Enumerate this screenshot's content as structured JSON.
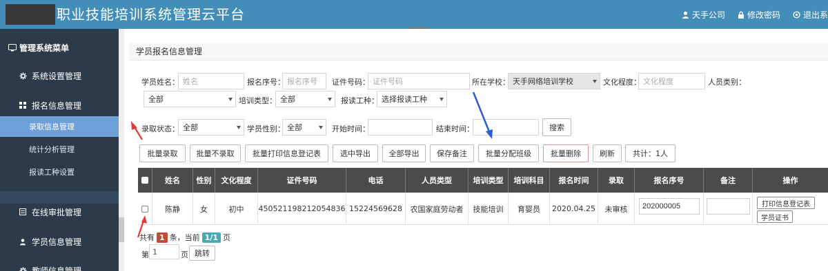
{
  "header": {
    "title": "职业技能培训系统管理云平台",
    "company": "天手公司",
    "change_password": "修改密码",
    "logout": "退出系"
  },
  "sidebar": {
    "menu_title": "管理系统菜单",
    "items": [
      {
        "label": "系统设置管理",
        "icon": "gear-icon"
      },
      {
        "label": "报名信息管理",
        "icon": "grid-icon"
      },
      {
        "label": "在线审批管理",
        "icon": "list-icon"
      },
      {
        "label": "学员信息管理",
        "icon": "user-icon"
      },
      {
        "label": "教师信息管理",
        "icon": "gear-icon"
      }
    ],
    "subitems": [
      {
        "label": "录取信息管理",
        "active": true
      },
      {
        "label": "统计分析管理",
        "active": false
      },
      {
        "label": "报读工种设置",
        "active": false
      }
    ]
  },
  "panel": {
    "title": "学员报名信息管理"
  },
  "filters": {
    "name_label": "学员姓名：",
    "name_placeholder": "姓名",
    "regno_label": "报名序号：",
    "regno_placeholder": "报名序号",
    "idno_label": "证件号码：",
    "idno_placeholder": "证件号码",
    "school_label": "所在学校：",
    "school_value": "天手网络培训学校",
    "edu_label": "文化程度：",
    "edu_placeholder": "文化程度",
    "persontype_label": "人员类别：",
    "persontype_value": "全部",
    "traintype_label": "培训类型：",
    "traintype_value": "全部",
    "trade_label": "报读工种：",
    "trade_value": "选择报读工种",
    "admit_label": "录取状态：",
    "admit_value": "全部",
    "gender_label": "学员性别：",
    "gender_value": "全部",
    "start_label": "开始时间：",
    "end_label": "结束时间：",
    "search_button": "搜索"
  },
  "toolbar": {
    "buttons": [
      "批量录取",
      "批量不录取",
      "批量打印信息登记表",
      "选中导出",
      "全部导出",
      "保存备注",
      "批量分配班级",
      "批量删除",
      "刷新",
      "共计：1人"
    ]
  },
  "table": {
    "headers": [
      "姓名",
      "性别",
      "文化程度",
      "证件号码",
      "电话",
      "人员类型",
      "培训类型",
      "培训科目",
      "报名时间",
      "录取",
      "报名序号",
      "备注",
      "操作"
    ],
    "rows": [
      {
        "name": "陈静",
        "gender": "女",
        "education": "初中",
        "id_number": "450521198212054836",
        "phone": "15224569628",
        "person_type": "农国家庭劳动者",
        "train_type": "技能培训",
        "subject": "育婴员",
        "reg_date": "2020.04.25",
        "admit": "未审核",
        "reg_no": "202000005",
        "remark": "",
        "action_print": "打印信息登记表",
        "action_cert": "学员证书"
      }
    ]
  },
  "pager": {
    "total_prefix": "共有",
    "total": "1",
    "total_suffix": "条，当前",
    "page": "1/1",
    "page_suffix": "页",
    "goto_prefix": "第",
    "goto_value": "1",
    "goto_suffix": "页",
    "goto_button": "跳转"
  },
  "colors": {
    "header_bg": "#438eb9",
    "sidebar_bg": "#2c3a4a",
    "sidebar_active": "#6f9fd8",
    "table_head": "#4b4b4b",
    "annotation_red": "#e53935",
    "annotation_blue": "#2e5bd8"
  }
}
